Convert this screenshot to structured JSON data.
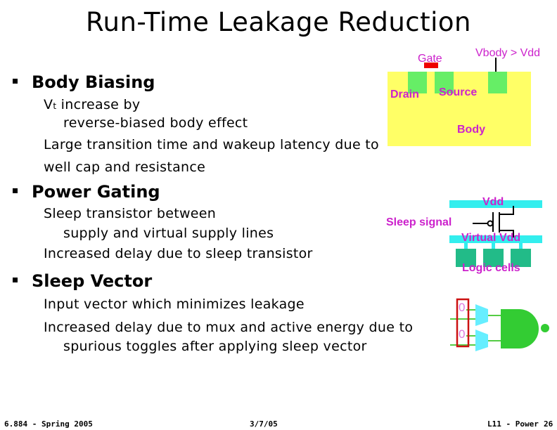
{
  "slide": {
    "title": "Run-Time Leakage Reduction",
    "sections": [
      {
        "heading": "Body Biasing",
        "lines": [
          "Vt increase by",
          "reverse-biased body effect",
          "Large transition time and wakeup latency due to",
          "well cap and resistance"
        ]
      },
      {
        "heading": "Power Gating",
        "lines": [
          "Sleep transistor between",
          "supply and virtual supply lines",
          "Increased delay due to sleep transistor"
        ]
      },
      {
        "heading": "Sleep Vector",
        "lines": [
          "Input vector which minimizes leakage",
          "Increased delay due to mux and active energy due to",
          "spurious toggles after applying sleep vector"
        ]
      }
    ]
  },
  "diagrams": {
    "body_bias": {
      "gate": "Gate",
      "vbody": "Vbody > Vdd",
      "drain": "Drain",
      "source": "Source",
      "body": "Body"
    },
    "power_gating": {
      "vdd": "Vdd",
      "sleep_signal": "Sleep signal",
      "virtual_vdd": "Virtual Vdd",
      "logic_cells": "Logic cells"
    },
    "sleep_vector": {
      "inputs": [
        "0",
        "0"
      ]
    }
  },
  "colors": {
    "label": "#cc22cc",
    "well": "#ffff66",
    "diffusion": "#66ee66",
    "gate": "#ee0000",
    "rail": "#33eeee",
    "cells": "#22bb88",
    "mux": "#66eeff",
    "nand": "#33cc33",
    "vector_box": "#cc1111"
  },
  "footer": {
    "left": "6.884 - Spring 2005",
    "center": "3/7/05",
    "right": "L11 - Power",
    "page": "26"
  }
}
